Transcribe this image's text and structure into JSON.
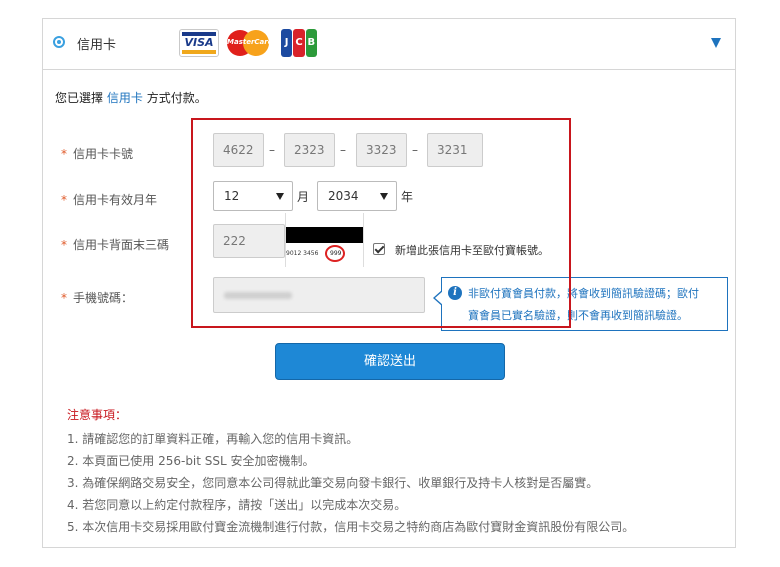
{
  "payment_header": {
    "method_label": "信用卡",
    "logos": {
      "visa": "VISA",
      "mastercard": "MasterCard",
      "jcb": [
        "J",
        "C",
        "B"
      ]
    },
    "expand_icon": "triangle-down-icon"
  },
  "chosen_text": {
    "prefix": "您已選擇",
    "method": "信用卡",
    "suffix": "方式付款。"
  },
  "form": {
    "card_number": {
      "label": "信用卡卡號",
      "parts": [
        "4622",
        "2323",
        "3323",
        "3231"
      ],
      "separator": "–"
    },
    "expiry": {
      "label": "信用卡有效月年",
      "month": "12",
      "month_unit": "月",
      "year": "2034",
      "year_unit": "年"
    },
    "cvv": {
      "label": "信用卡背面末三碼",
      "value": "222",
      "card_digits": "9012 3456",
      "card_cvv": "999"
    },
    "save_card": {
      "checked": true,
      "label": "新增此張信用卡至歐付寶帳號。"
    },
    "phone": {
      "label": "手機號碼："
    },
    "tooltip": {
      "line1": "非歐付寶會員付款，將會收到簡訊驗證碼；歐付",
      "line2": "寶會員已實名驗證，則不會再收到簡訊驗證。"
    }
  },
  "submit_label": "確認送出",
  "notes": {
    "title": "注意事項：",
    "items": [
      "1. 請確認您的訂單資料正確，再輸入您的信用卡資訊。",
      "2. 本頁面已使用 256-bit SSL 安全加密機制。",
      "3. 為確保網路交易安全，您同意本公司得就此筆交易向發卡銀行、收單銀行及持卡人核對是否屬實。",
      "4. 若您同意以上約定付款程序，請按「送出」以完成本次交易。",
      "5. 本次信用卡交易採用歐付寶金流機制進行付款，信用卡交易之特約商店為歐付寶財金資訊股份有限公司。"
    ]
  },
  "colors": {
    "accent": "#1e73be",
    "button": "#1e88d6",
    "highlight_box": "#c8161d",
    "required_star": "#e05a2a"
  }
}
